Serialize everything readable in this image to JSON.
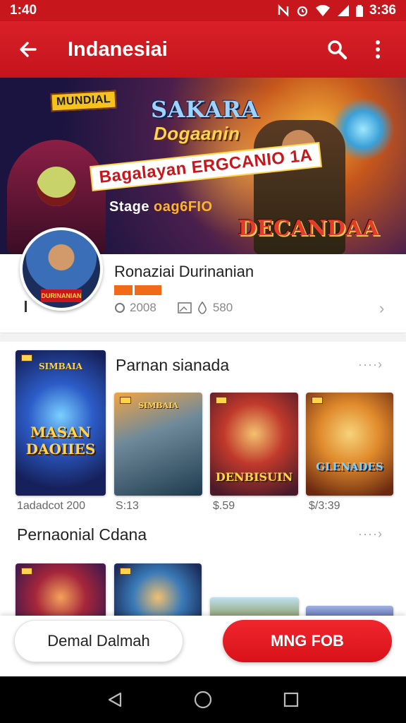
{
  "status_bar": {
    "left_time": "1:40",
    "right_time": "3:36",
    "icons": [
      "nfc-icon",
      "alarm-icon",
      "wifi-icon",
      "signal-icon",
      "battery-icon"
    ]
  },
  "app_bar": {
    "title": "Indanesiai",
    "back_icon": "arrow-left-icon",
    "search_icon": "search-icon",
    "more_icon": "more-vertical-icon"
  },
  "hero": {
    "badge": "MUNDIAL",
    "title_main": "SAKARA",
    "title_sub": "Dogaanin",
    "ribbon": "Bagalayan ERGCANIO 1A",
    "tag_prefix": "Stage ",
    "tag_highlight": "oag6FIO",
    "logo": "DECANDAA"
  },
  "profile": {
    "name": "Ronaziai Durinanian",
    "avatar_plate": "DURINANIAN",
    "stat1_value": "2008",
    "stat2_value": "580",
    "chevron": "›"
  },
  "section1": {
    "title": "Parnan sianada",
    "more": "····›",
    "items": [
      {
        "caption_top": "SIMBAIA",
        "caption": "MASAN DAOIIES",
        "price": "1adadcot 200"
      },
      {
        "caption_top": "SIMBAIA",
        "caption": "",
        "price": "S:13"
      },
      {
        "caption_top": "",
        "caption": "DENBISUIN",
        "price": "$.59"
      },
      {
        "caption_top": "",
        "caption": "GLENADES",
        "price": "$/3:39"
      }
    ]
  },
  "section2": {
    "title": "Pernaonial  Cdana",
    "more": "····›"
  },
  "actions": {
    "secondary_label": "Demal Dalmah",
    "primary_label": "MNG FOB"
  },
  "colors": {
    "brand_red": "#c8161d",
    "accent_orange": "#f06a1a"
  }
}
